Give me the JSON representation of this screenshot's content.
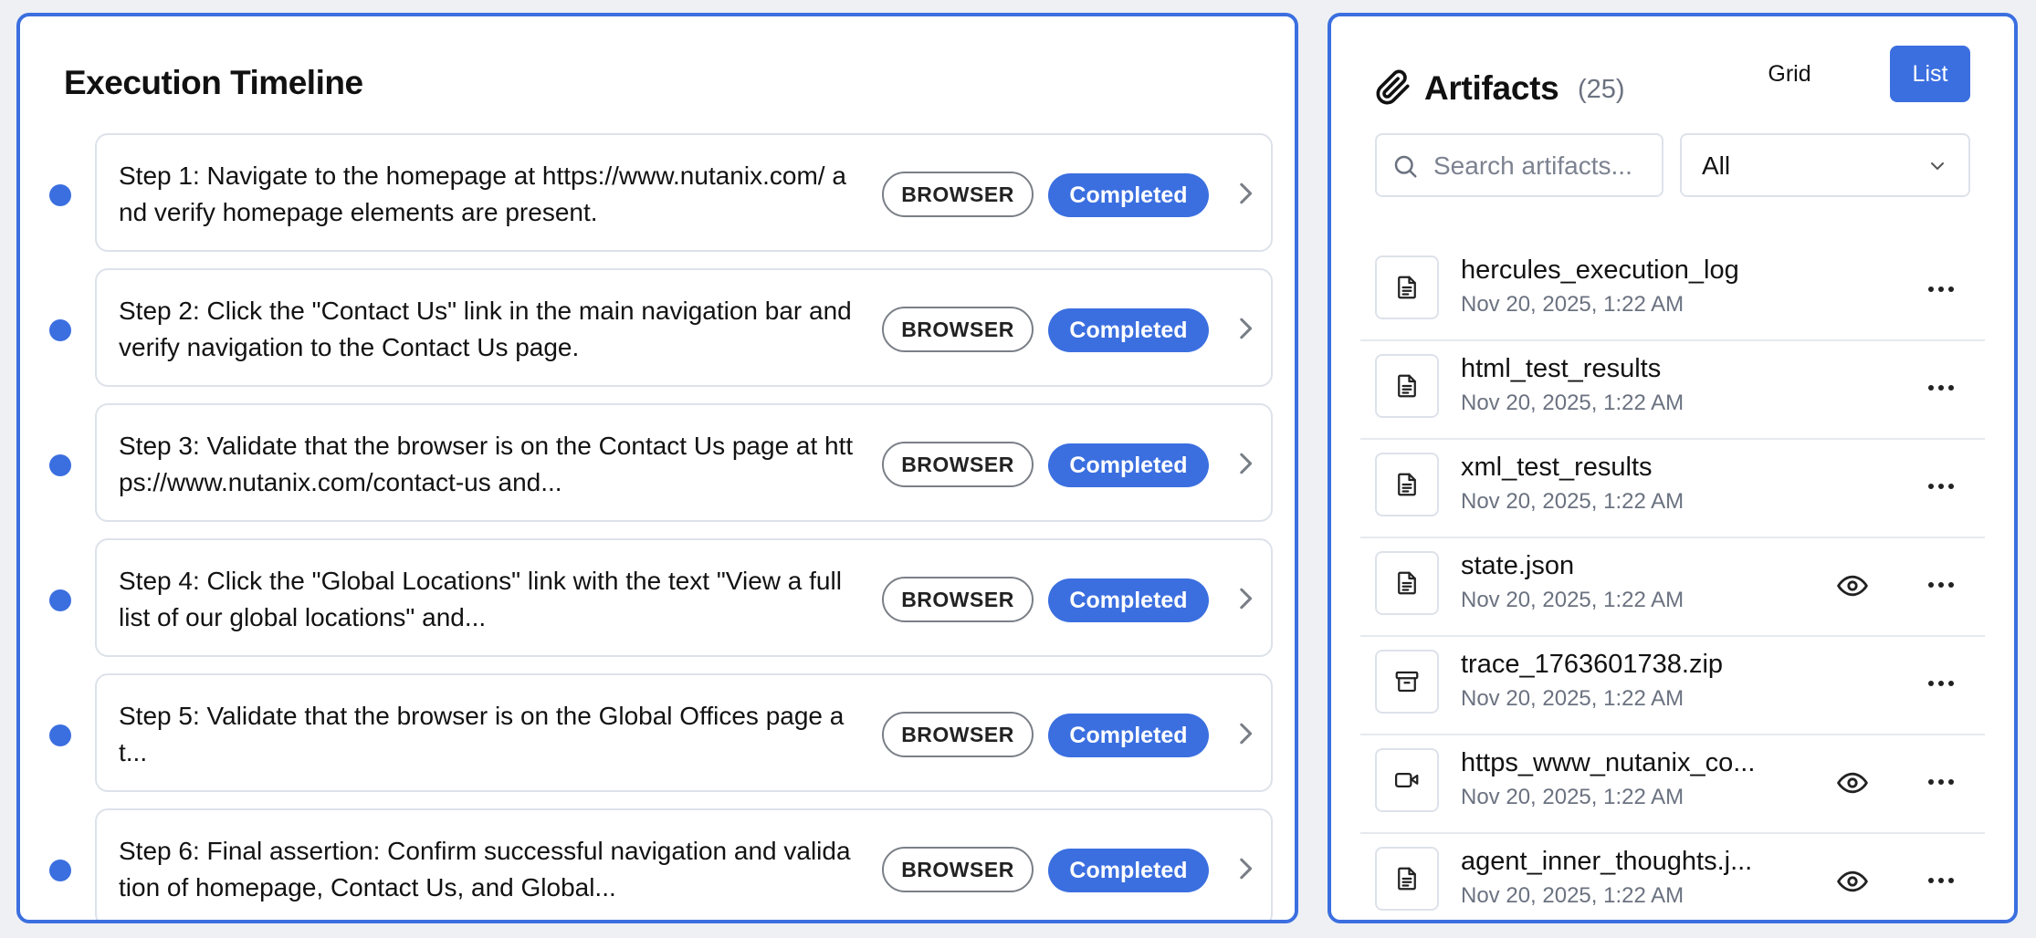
{
  "timeline": {
    "title": "Execution Timeline",
    "steps": [
      {
        "text": "Step 1: Navigate to the homepage at https://www.nutanix.com/ and verify homepage elements are present.",
        "tag": "BROWSER",
        "status": "Completed"
      },
      {
        "text": "Step 2: Click the \"Contact Us\" link in the main navigation bar and verify navigation to the Contact Us page.",
        "tag": "BROWSER",
        "status": "Completed"
      },
      {
        "text": "Step 3: Validate that the browser is on the Contact Us page at https://www.nutanix.com/contact-us and...",
        "tag": "BROWSER",
        "status": "Completed"
      },
      {
        "text": "Step 4: Click the \"Global Locations\" link with the text \"View a full list of our global locations\" and...",
        "tag": "BROWSER",
        "status": "Completed"
      },
      {
        "text": "Step 5: Validate that the browser is on the Global Offices page at...",
        "tag": "BROWSER",
        "status": "Completed"
      },
      {
        "text": "Step 6: Final assertion: Confirm successful navigation and validation of homepage, Contact Us, and Global...",
        "tag": "BROWSER",
        "status": "Completed"
      }
    ]
  },
  "artifacts": {
    "title": "Artifacts",
    "count": "(25)",
    "view_grid": "Grid",
    "view_list": "List",
    "search_placeholder": "Search artifacts...",
    "filter_value": "All",
    "items": [
      {
        "name": "hercules_execution_log",
        "date": "Nov 20, 2025, 1:22 AM",
        "icon": "document-icon",
        "preview": false
      },
      {
        "name": "html_test_results",
        "date": "Nov 20, 2025, 1:22 AM",
        "icon": "document-icon",
        "preview": false
      },
      {
        "name": "xml_test_results",
        "date": "Nov 20, 2025, 1:22 AM",
        "icon": "document-icon",
        "preview": false
      },
      {
        "name": "state.json",
        "date": "Nov 20, 2025, 1:22 AM",
        "icon": "document-icon",
        "preview": true
      },
      {
        "name": "trace_1763601738.zip",
        "date": "Nov 20, 2025, 1:22 AM",
        "icon": "archive-icon",
        "preview": false
      },
      {
        "name": "https_www_nutanix_co...",
        "date": "Nov 20, 2025, 1:22 AM",
        "icon": "video-icon",
        "preview": true
      },
      {
        "name": "agent_inner_thoughts.j...",
        "date": "Nov 20, 2025, 1:22 AM",
        "icon": "document-icon",
        "preview": true
      }
    ]
  },
  "colors": {
    "accent": "#3b6fe0",
    "border": "#dde2ea",
    "muted_text": "#6b7280"
  }
}
